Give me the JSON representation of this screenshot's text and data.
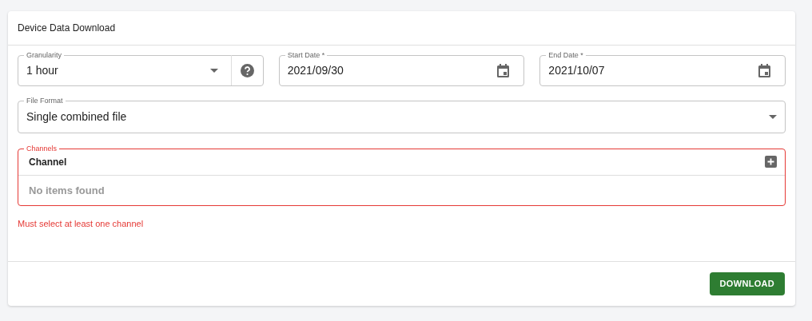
{
  "header": {
    "title": "Device Data Download"
  },
  "fields": [
    {
      "kind": "select",
      "label": "Granularity",
      "value": "1 hour",
      "help": true
    },
    {
      "kind": "date",
      "label": "Start Date *",
      "value": "2021/09/30"
    },
    {
      "kind": "date",
      "label": "End Date *",
      "value": "2021/10/07"
    }
  ],
  "file_format": {
    "label": "File Format",
    "value": "Single combined file"
  },
  "channels": {
    "label": "Channels",
    "column": "Channel",
    "empty_text": "No items found",
    "invalid": true,
    "error": "Must select at least one channel"
  },
  "button": "DOWNLOAD"
}
